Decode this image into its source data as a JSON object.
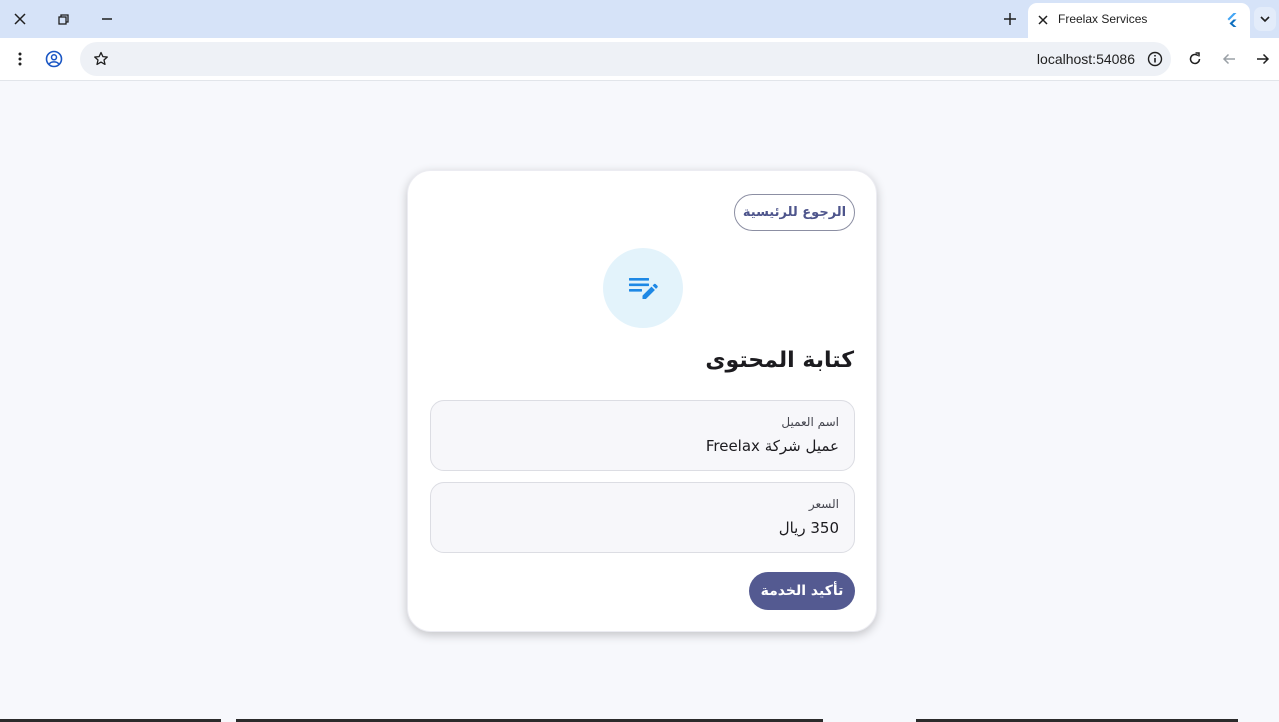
{
  "browser": {
    "tab_title": "Freelax Services",
    "url": "localhost:54086",
    "icons": [
      "close-icon",
      "restore-icon",
      "minimize-icon",
      "new-tab-icon",
      "tab-close-icon",
      "flutter-icon",
      "tab-search-icon",
      "menu-icon",
      "profile-icon",
      "star-icon",
      "info-icon",
      "reload-icon",
      "back-icon",
      "forward-icon"
    ]
  },
  "page": {
    "back_label": "الرجوع للرئيسية",
    "service_icon": "edit-note-icon",
    "title": "كتابة المحتوى",
    "fields": [
      {
        "label": "اسم العميل",
        "value": "عميل شركة Freelax"
      },
      {
        "label": "السعر",
        "value": "350 ريال"
      }
    ],
    "confirm_label": "تأكيد الخدمة"
  },
  "colors": {
    "primary": "#545a91",
    "icon_bg": "#e3f3fb",
    "icon_fg": "#1e88e5",
    "tabbar": "#d6e3f8"
  }
}
